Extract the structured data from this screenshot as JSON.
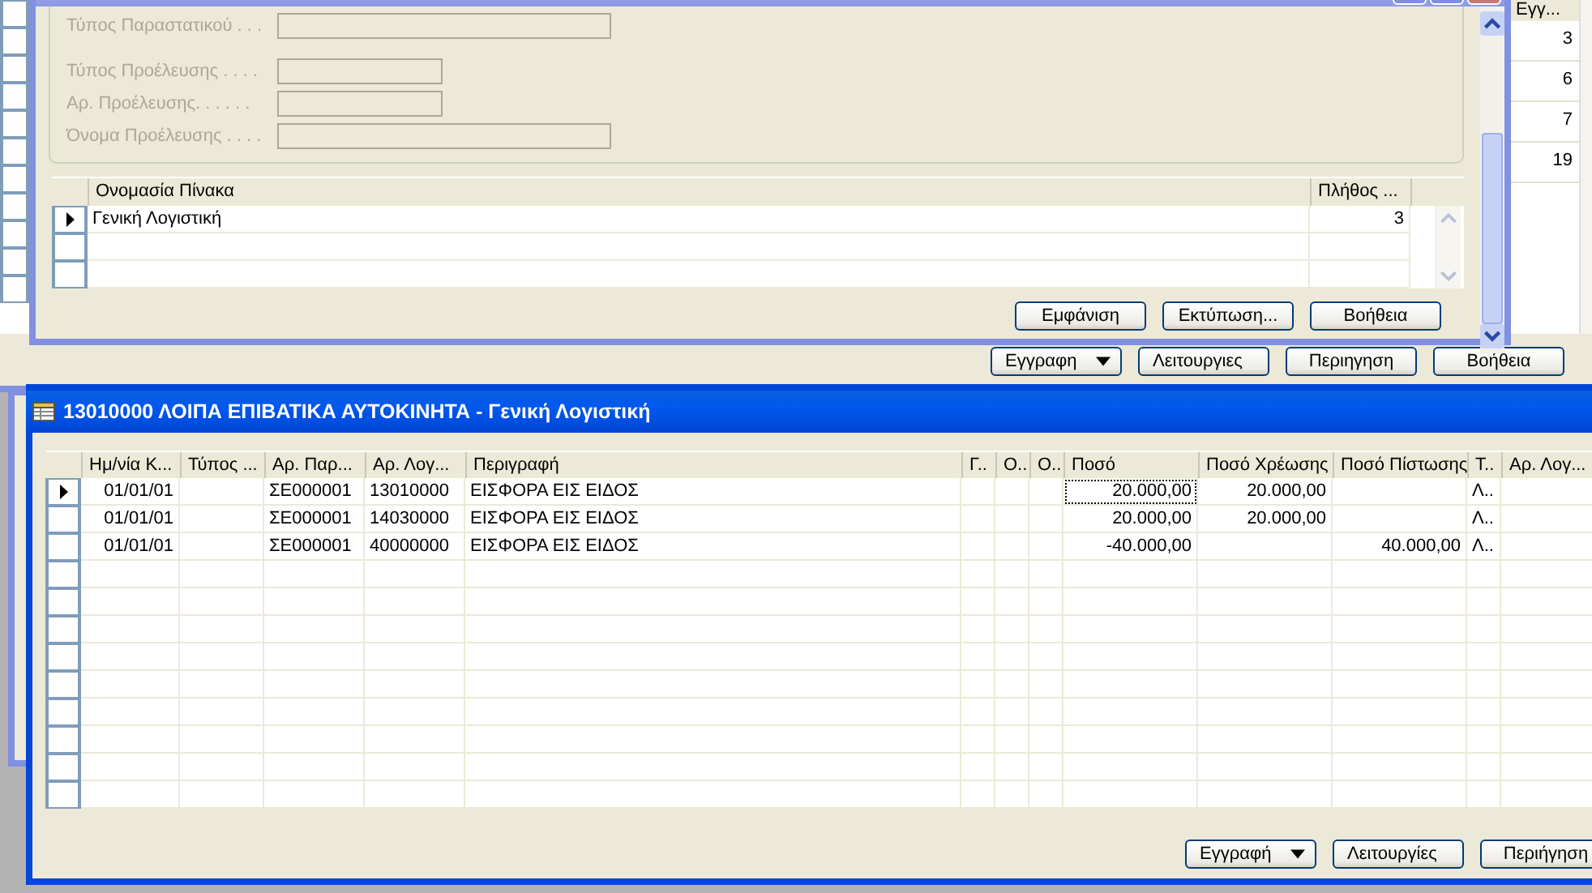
{
  "back_window": {
    "active": false,
    "column_header": "Εγγ...",
    "values": [
      "3",
      "6",
      "7",
      "19"
    ],
    "buttons": [
      {
        "label": "Εγγραφη",
        "kind": "menu"
      },
      {
        "label": "Λειτουργιες",
        "kind": "menu"
      },
      {
        "label": "Περιηγηση",
        "kind": "plain"
      },
      {
        "label": "Βοήθεια",
        "kind": "plain"
      }
    ]
  },
  "side_window": {
    "active": false
  },
  "form_window": {
    "active": false,
    "fields": [
      {
        "label": "Τύπος Παραστατικού . . .",
        "kind": "long",
        "disabled": true
      },
      {
        "label": "Τύπος Προέλευσης . . . .",
        "kind": "short",
        "disabled": true
      },
      {
        "label": "Αρ. Προέλευσης. . . . . .",
        "kind": "short",
        "disabled": true
      },
      {
        "label": "Όνομα Προέλευσης . . . .",
        "kind": "long",
        "disabled": true
      }
    ],
    "table": {
      "columns": [
        "Ονομασία Πίνακα",
        "Πλήθος ..."
      ],
      "rows": [
        {
          "current": true,
          "cells": [
            "Γενική Λογιστική",
            "3"
          ]
        }
      ]
    },
    "buttons": [
      "Εμφάνιση",
      "Εκτύπωση...",
      "Βοήθεια"
    ]
  },
  "ledger_window": {
    "active": true,
    "title": "13010000 ΛΟΙΠΑ ΕΠΙΒΑΤΙΚΑ ΑΥΤΟΚΙΝΗΤΑ - Γενική Λογιστική",
    "columns": [
      {
        "label": "Ημ/νία Κ...",
        "kind": "number"
      },
      {
        "label": "Τύπος ...",
        "kind": "text"
      },
      {
        "label": "Αρ. Παρ...",
        "kind": "text"
      },
      {
        "label": "Αρ. Λογ...",
        "kind": "text"
      },
      {
        "label": "Περιγραφή",
        "kind": "text"
      },
      {
        "label": "Γ..",
        "kind": "text"
      },
      {
        "label": "Ο..",
        "kind": "text"
      },
      {
        "label": "Ο..",
        "kind": "text"
      },
      {
        "label": "Ποσό",
        "kind": "number",
        "focus": true
      },
      {
        "label": "Ποσό Χρέωσης",
        "kind": "number"
      },
      {
        "label": "Ποσό Πίστωσης",
        "kind": "number"
      },
      {
        "label": "Τ..",
        "kind": "text"
      },
      {
        "label": "Αρ. Λογ...",
        "kind": "text"
      }
    ],
    "rows": [
      {
        "current": true,
        "cells": [
          "01/01/01",
          null,
          "ΣΕ000001",
          "13010000",
          "ΕΙΣΦΟΡΑ ΕΙΣ ΕΙΔΟΣ",
          null,
          null,
          null,
          "20.000,00",
          "20.000,00",
          null,
          "Λ..",
          null
        ]
      },
      {
        "current": false,
        "cells": [
          "01/01/01",
          null,
          "ΣΕ000001",
          "14030000",
          "ΕΙΣΦΟΡΑ ΕΙΣ ΕΙΔΟΣ",
          null,
          null,
          null,
          "20.000,00",
          "20.000,00",
          null,
          "Λ..",
          null
        ]
      },
      {
        "current": false,
        "cells": [
          "01/01/01",
          null,
          "ΣΕ000001",
          "40000000",
          "ΕΙΣΦΟΡΑ ΕΙΣ ΕΙΔΟΣ",
          null,
          null,
          null,
          "-40.000,00",
          null,
          "40.000,00",
          "Λ..",
          null
        ]
      }
    ],
    "buttons": [
      {
        "label": "Εγγραφή",
        "kind": "menu"
      },
      {
        "label": "Λειτουργίες",
        "kind": "menu"
      },
      {
        "label": "Περιήγηση",
        "kind": "plain"
      }
    ]
  }
}
